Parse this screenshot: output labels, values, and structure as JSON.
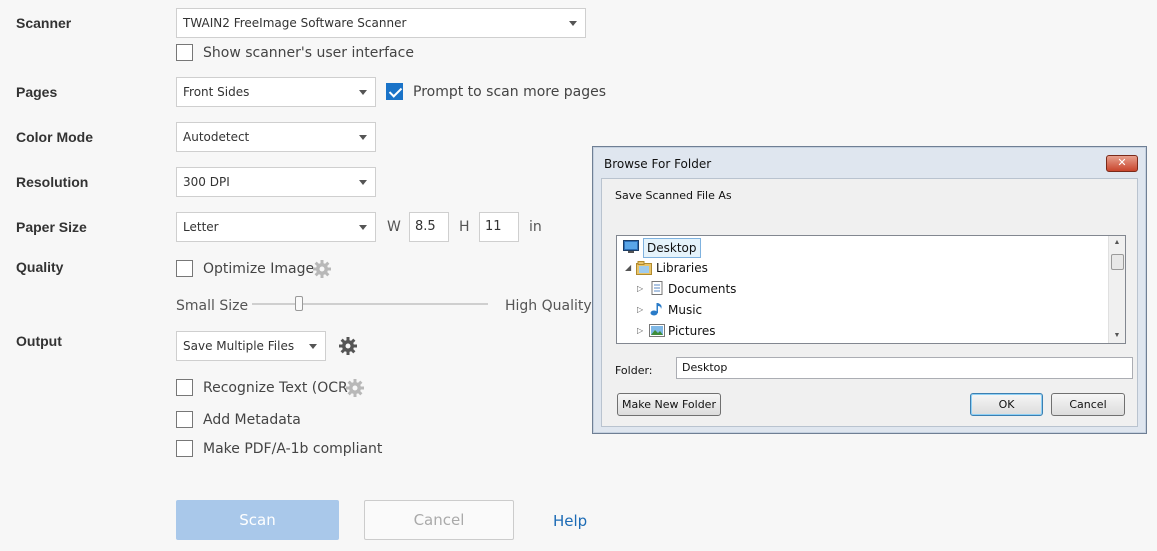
{
  "form": {
    "scanner_label": "Scanner",
    "scanner_value": "TWAIN2 FreeImage Software Scanner",
    "show_ui_label": "Show scanner's user interface",
    "show_ui_checked": false,
    "pages_label": "Pages",
    "pages_value": "Front Sides",
    "prompt_label": "Prompt to scan more pages",
    "prompt_checked": true,
    "color_label": "Color Mode",
    "color_value": "Autodetect",
    "resolution_label": "Resolution",
    "resolution_value": "300 DPI",
    "paper_label": "Paper Size",
    "paper_value": "Letter",
    "w_label": "W",
    "w_value": "8.5",
    "h_label": "H",
    "h_value": "11",
    "unit_label": "in",
    "quality_label": "Quality",
    "optimize_label": "Optimize Image",
    "small_size_label": "Small Size",
    "high_quality_label": "High Quality",
    "quality_slider_level": 0.2,
    "output_label": "Output",
    "output_value": "Save Multiple Files",
    "ocr_label": "Recognize Text (OCR)",
    "metadata_label": "Add Metadata",
    "pdfa_label": "Make PDF/A-1b compliant",
    "scan_button": "Scan",
    "cancel_button": "Cancel",
    "help_link": "Help"
  },
  "dialog": {
    "title": "Browse For Folder",
    "close_glyph": "✕",
    "description": "Save Scanned File As",
    "tree": [
      {
        "label": "Desktop",
        "icon": "desktop-icon",
        "selected": true
      },
      {
        "label": "Libraries",
        "icon": "libraries-icon",
        "expanded": true
      },
      {
        "label": "Documents",
        "icon": "documents-icon"
      },
      {
        "label": "Music",
        "icon": "music-icon"
      },
      {
        "label": "Pictures",
        "icon": "pictures-icon"
      }
    ],
    "folder_label": "Folder:",
    "folder_value": "Desktop",
    "new_folder_button": "Make New Folder",
    "ok_button": "OK",
    "cancel_button": "Cancel"
  },
  "colors": {
    "accent": "#1a73c8",
    "scan_button_bg": "#a9c8ea",
    "help_link": "#1c6bb5",
    "dialog_frame": "#dfe6ef"
  }
}
